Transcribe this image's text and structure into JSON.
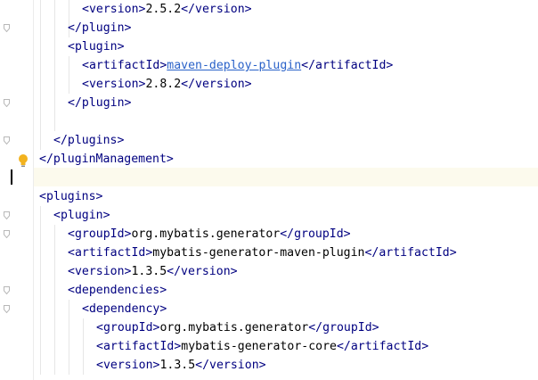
{
  "editor": {
    "lines": [
      {
        "indent": 6,
        "open": "version",
        "value": "2.5.2",
        "link": false
      },
      {
        "indent": 4,
        "close": "plugin"
      },
      {
        "indent": 4,
        "open": "plugin"
      },
      {
        "indent": 6,
        "open": "artifactId",
        "value": "maven-deploy-plugin",
        "link": true
      },
      {
        "indent": 6,
        "open": "version",
        "value": "2.8.2",
        "link": false
      },
      {
        "indent": 4,
        "close": "plugin"
      },
      {
        "blank": true
      },
      {
        "indent": 2,
        "close": "plugins"
      },
      {
        "indent": 0,
        "close": "pluginManagement"
      },
      {
        "blank": true,
        "caret": true
      },
      {
        "indent": 0,
        "open": "plugins"
      },
      {
        "indent": 2,
        "open": "plugin"
      },
      {
        "indent": 4,
        "open": "groupId",
        "value": "org.mybatis.generator",
        "link": false
      },
      {
        "indent": 4,
        "open": "artifactId",
        "value": "mybatis-generator-maven-plugin",
        "link": false
      },
      {
        "indent": 4,
        "open": "version",
        "value": "1.3.5",
        "link": false
      },
      {
        "indent": 4,
        "open": "dependencies"
      },
      {
        "indent": 6,
        "open": "dependency"
      },
      {
        "indent": 8,
        "open": "groupId",
        "value": "org.mybatis.generator",
        "link": false
      },
      {
        "indent": 8,
        "open": "artifactId",
        "value": "mybatis-generator-core",
        "link": false
      },
      {
        "indent": 8,
        "open": "version",
        "value": "1.3.5",
        "link": false
      }
    ]
  },
  "gutter": {
    "icons": [
      "fold-end-icon",
      "intention-bulb-icon"
    ]
  },
  "colors": {
    "tag": "#000080",
    "text": "#000000",
    "link": "#2a62c9",
    "caret_line": "#fcfaed",
    "indent_guide": "#e6e6e6"
  }
}
